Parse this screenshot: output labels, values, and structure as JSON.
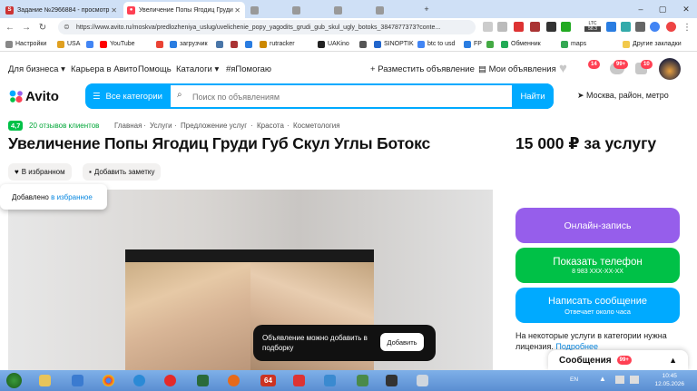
{
  "browser": {
    "tabs": [
      {
        "label": "Задание №2966884 - просмотр",
        "icon": "sp-icon",
        "active": false
      },
      {
        "label": "Увеличение Попы Ягодиц Груди",
        "icon": "avito-icon",
        "active": true
      },
      {
        "label": "",
        "icon": "tab-icon",
        "active": false
      },
      {
        "label": "",
        "icon": "tab-icon",
        "active": false
      },
      {
        "label": "",
        "icon": "tab-icon",
        "active": false
      },
      {
        "label": "",
        "icon": "tab-icon",
        "active": false
      }
    ],
    "url": "https://www.avito.ru/moskva/predlozheniya_uslug/uvelichenie_popy_yagodits_grudi_gub_skul_ugly_botoks_3847877373?conte...",
    "extension_labels": {
      "ltc": "LTC",
      "ltc_value": "58.3"
    },
    "bookmarks": [
      {
        "label": "Настройки",
        "color": "#888888"
      },
      {
        "label": "USA",
        "color": "#e0a020"
      },
      {
        "label": "",
        "color": "#4285f4"
      },
      {
        "label": "YouTube",
        "color": "#ff0000"
      },
      {
        "label": "",
        "color": "#ea4335"
      },
      {
        "label": "загрузчик",
        "color": "#2a7de1"
      },
      {
        "label": "",
        "color": "#4a76a8"
      },
      {
        "label": "",
        "color": "#aa3333"
      },
      {
        "label": "",
        "color": "#2a7de1"
      },
      {
        "label": "rutracker",
        "color": "#cc8800"
      },
      {
        "label": "UAKino",
        "color": "#222222"
      },
      {
        "label": "",
        "color": "#555555"
      },
      {
        "label": "SINOPTIK",
        "color": "#2266cc"
      },
      {
        "label": "btc to usd",
        "color": "#4285f4"
      },
      {
        "label": "FP",
        "color": "#2a7de1"
      },
      {
        "label": "",
        "color": "#44aa44"
      },
      {
        "label": "Обменник",
        "color": "#22aa55"
      },
      {
        "label": "maps",
        "color": "#34a853"
      },
      {
        "label": "Другие закладки",
        "color": "#f2c94c"
      }
    ]
  },
  "header": {
    "links": [
      "Для бизнеса",
      "Карьера в Авито",
      "Помощь",
      "Каталоги",
      "#яПомогаю"
    ],
    "post_ad": "Разместить объявление",
    "my_ads": "Мои объявления",
    "badges": {
      "favorites": "14",
      "messages": "99+",
      "cart": "10"
    },
    "logo": "Avito",
    "categories_button": "Все категории",
    "search_placeholder": "Поиск по объявлениям",
    "search_button": "Найти",
    "location": "Москва, район, метро"
  },
  "breadcrumbs": {
    "rating": "4,7",
    "reviews": "20 отзывов клиентов",
    "items": [
      "Главная",
      "Услуги",
      "Предложение услуг",
      "Красота",
      "Косметология"
    ]
  },
  "listing": {
    "title": "Увеличение Попы Ягодиц Груди Губ Скул Углы Ботокс",
    "price": "15 000 ₽ за услугу",
    "favorite_label": "В избранном",
    "note_label": "Добавить заметку",
    "added_toast": {
      "text": "Добавлено",
      "link": "в избранное"
    },
    "collection_toast": {
      "text": "Объявление можно добавить в подборку",
      "button": "Добавить"
    },
    "online_booking": "Онлайн-запись",
    "show_phone": "Показать телефон",
    "phone": "8 983 XXX-XX-XX",
    "write_message": "Написать сообщение",
    "reply_time": "Отвечает около часа",
    "license_text": "На некоторые услуги в категории нужна лицензия.",
    "license_link": "Подробнее"
  },
  "messages_widget": {
    "label": "Сообщения",
    "badge": "99+"
  },
  "taskbar": {
    "lang": "EN",
    "time": "10:45",
    "date": "12.05.2026",
    "number_icon": "64"
  },
  "colors": {
    "accent": "#00aaff",
    "purple": "#965eeb",
    "green": "#00c147",
    "blue": "#00aaff",
    "badge": "#ff4053"
  }
}
